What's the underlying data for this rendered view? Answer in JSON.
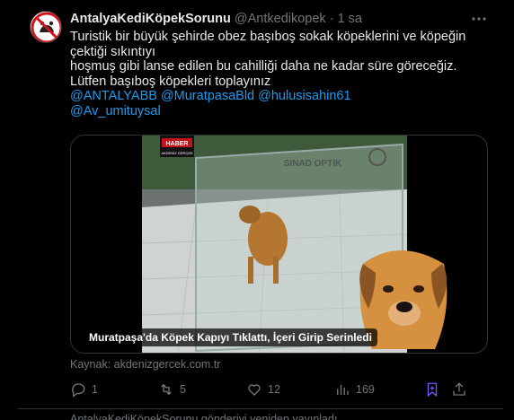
{
  "tweet": {
    "display_name": "AntalyaKediKöpekSorunu",
    "handle": "@Antkedikopek",
    "dot": "·",
    "time": "1 sa",
    "lines": [
      "Turistik bir büyük şehirde obez başıboş sokak köpeklerini ve köpeğin çektiği sıkıntıyı",
      "hoşmuş gibi lanse edilen bu cahilliği daha ne kadar süre göreceğiz.",
      "Lütfen başıboş köpekleri toplayınız"
    ],
    "mentions_line1": "@ANTALYABB @MuratpasaBld @hulusisahin61",
    "mentions_line2": "@Av_umituysal",
    "media": {
      "caption": "Muratpaşa'da Köpek Kapıyı Tıklattı, İçeri Girip Serinledi",
      "sign_text": "SINAD OPTİK",
      "badge_top": "HABER",
      "badge_bottom": "AKDENİZ GERÇEK"
    },
    "source": "Kaynak: akdenizgercek.com.tr",
    "actions": {
      "replies": "1",
      "retweets": "5",
      "likes": "12",
      "views": "169"
    },
    "colors": {
      "accent": "#1d9bf0",
      "muted": "#71767b",
      "bookmark": "#7856ff"
    }
  },
  "next_tweet_header": "AntalyaKediKöpekSorunu gönderiyi yeniden yayınladı"
}
